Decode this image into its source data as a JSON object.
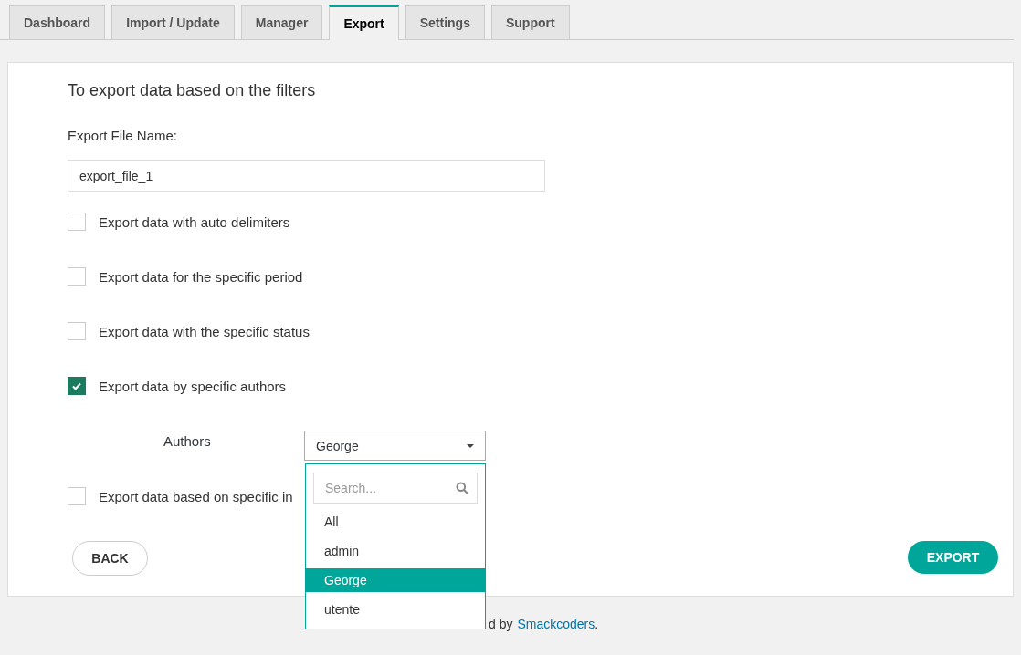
{
  "tabs": [
    {
      "label": "Dashboard",
      "selected": false
    },
    {
      "label": "Import / Update",
      "selected": false
    },
    {
      "label": "Manager",
      "selected": false
    },
    {
      "label": "Export",
      "selected": true
    },
    {
      "label": "Settings",
      "selected": false
    },
    {
      "label": "Support",
      "selected": false
    }
  ],
  "heading": "To export data based on the filters",
  "file_name": {
    "label": "Export File Name:",
    "value": "export_file_1"
  },
  "options": [
    {
      "label": "Export data with auto delimiters",
      "checked": false
    },
    {
      "label": "Export data for the specific period",
      "checked": false
    },
    {
      "label": "Export data with the specific status",
      "checked": false
    },
    {
      "label": "Export data by specific authors",
      "checked": true
    },
    {
      "label": "Export data based on specific in",
      "checked": false
    }
  ],
  "authors": {
    "label": "Authors",
    "value": "George",
    "expanded": true,
    "search_placeholder": "Search...",
    "items": [
      {
        "label": "All",
        "selected": false
      },
      {
        "label": "admin",
        "selected": false
      },
      {
        "label": "George",
        "selected": true
      },
      {
        "label": "utente",
        "selected": false
      }
    ]
  },
  "buttons": {
    "back": "BACK",
    "export": "EXPORT"
  },
  "footer": {
    "text": "d by",
    "link": "Smackcoders",
    "end": "."
  }
}
